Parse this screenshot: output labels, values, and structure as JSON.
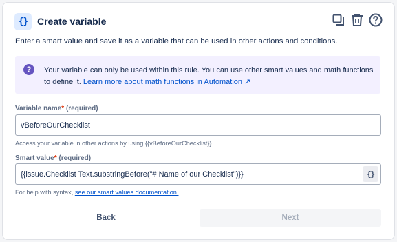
{
  "header": {
    "icon_text": "{}",
    "title": "Create variable",
    "icons": [
      "duplicate-icon",
      "trash-icon",
      "help-icon"
    ]
  },
  "description": "Enter a smart value and save it as a variable that can be used in other actions and conditions.",
  "info": {
    "icon": "question-icon",
    "text": "Your variable can only be used within this rule. You can use other smart values and math functions to define it. ",
    "link": "Learn more about math functions in Automation ↗"
  },
  "variable_name": {
    "label": "Variable name",
    "required_mark": "*",
    "required_text": " (required)",
    "value": "vBeforeOurChecklist",
    "helper": "Access your variable in other actions by using {{vBeforeOurChecklist}}"
  },
  "smart_value": {
    "label": "Smart value",
    "required_mark": "*",
    "required_text": " (required)",
    "value": "{{issue.Checklist Text.substringBefore(\"# Name of our Checklist\")}}",
    "button_text": "{}",
    "helper_prefix": "For help with syntax, ",
    "helper_link": "see our smart values documentation."
  },
  "buttons": {
    "back": "Back",
    "next": "Next"
  },
  "colors": {
    "accent": "#0052cc",
    "info_bg": "#f3f0ff",
    "info_icon": "#6554c0",
    "required": "#de350b"
  }
}
